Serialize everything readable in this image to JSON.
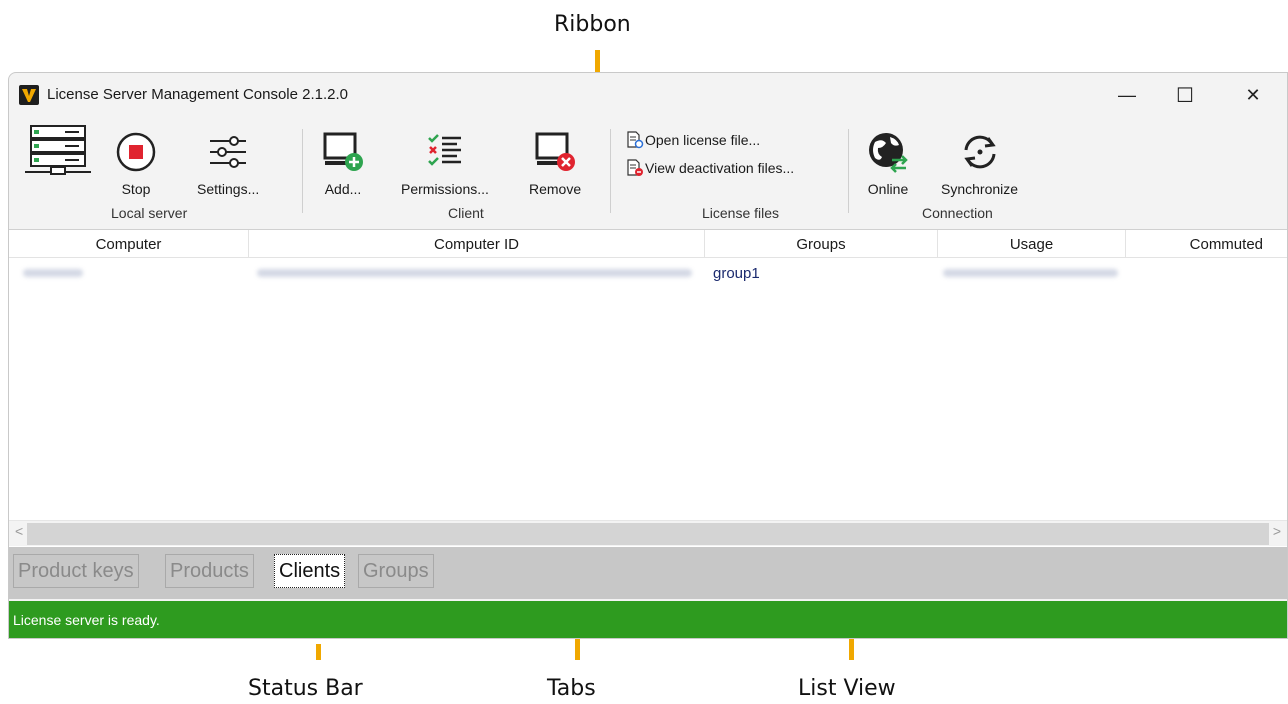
{
  "annotations": {
    "ribbon": "Ribbon",
    "status_bar": "Status Bar",
    "tabs": "Tabs",
    "list_view": "List View"
  },
  "window": {
    "title": "License Server Management Console 2.1.2.0",
    "minimize": "—",
    "maximize": "☐",
    "close": "✕"
  },
  "ribbon": {
    "local_server": {
      "label": "Local server",
      "stop": "Stop",
      "settings": "Settings..."
    },
    "client": {
      "label": "Client",
      "add": "Add...",
      "permissions": "Permissions...",
      "remove": "Remove"
    },
    "license_files": {
      "label": "License files",
      "open": "Open license file...",
      "view_deactivation": "View deactivation files..."
    },
    "connection": {
      "label": "Connection",
      "online": "Online",
      "synchronize": "Synchronize"
    }
  },
  "list": {
    "columns": [
      "Computer",
      "Computer ID",
      "Groups",
      "Usage",
      "Commuted"
    ],
    "rows": [
      {
        "groups": "group1"
      }
    ],
    "scroll_left": "<",
    "scroll_right": ">"
  },
  "tabs": [
    "Product keys",
    "Products",
    "Clients",
    "Groups"
  ],
  "status": {
    "text": "License server is ready."
  },
  "colors": {
    "accent_annotation": "#f0a800",
    "status_green": "#2e9b1f",
    "stop_red": "#e0242f",
    "add_green": "#2ea44f"
  }
}
